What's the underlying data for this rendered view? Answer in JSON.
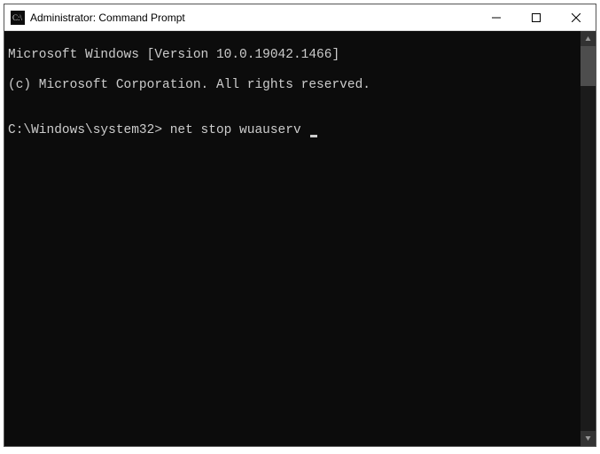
{
  "titlebar": {
    "title": "Administrator: Command Prompt"
  },
  "console": {
    "line1": "Microsoft Windows [Version 10.0.19042.1466]",
    "line2": "(c) Microsoft Corporation. All rights reserved.",
    "blank": "",
    "prompt": "C:\\Windows\\system32>",
    "command": "net stop wuauserv"
  }
}
